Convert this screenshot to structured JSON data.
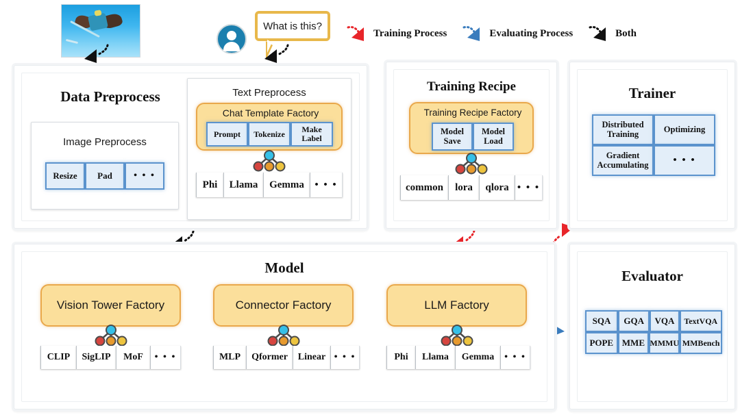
{
  "top": {
    "image_thumb_name": "input-image-kite",
    "user_avatar_name": "user-avatar-icon",
    "question": "What is this?"
  },
  "legend": {
    "items": [
      {
        "label": "Training Process",
        "color": "#e8252a",
        "icon": "red-dotted-arrow-icon"
      },
      {
        "label": "Evaluating Process",
        "color": "#3a7cbd",
        "icon": "blue-dotted-arrow-icon"
      },
      {
        "label": "Both",
        "color": "#111111",
        "icon": "black-dotted-arrow-icon"
      }
    ]
  },
  "colors": {
    "chip_fill": "#e3eef9",
    "chip_border": "#5b93cd",
    "factory_fill": "#fbdf9b",
    "factory_border": "#e9a84b",
    "training_arrow": "#e8252a",
    "evaluating_arrow": "#3a7cbd",
    "both_arrow": "#111111"
  },
  "panels": {
    "data_preprocess": {
      "title": "Data Preprocess",
      "image_preprocess": {
        "title": "Image Preprocess",
        "chips": [
          "Resize",
          "Pad",
          "• • •"
        ]
      },
      "text_preprocess": {
        "title": "Text Preprocess",
        "factory": {
          "title": "Chat Template Factory",
          "chips": [
            "Prompt",
            "Tokenize",
            "Make Label"
          ]
        },
        "options": [
          "Phi",
          "Llama",
          "Gemma",
          "• • •"
        ]
      }
    },
    "training_recipe": {
      "title": "Training Recipe",
      "factory": {
        "title": "Training Recipe Factory",
        "chips": [
          "Model Save",
          "Model Load"
        ]
      },
      "options": [
        "common",
        "lora",
        "qlora",
        "• • •"
      ]
    },
    "trainer": {
      "title": "Trainer",
      "chips": [
        "Distributed Training",
        "Optimizing",
        "Gradient Accumulating",
        "• • •"
      ]
    },
    "model": {
      "title": "Model",
      "factories": [
        {
          "title": "Vision Tower Factory",
          "options": [
            "CLIP",
            "SigLIP",
            "MoF",
            "• • •"
          ]
        },
        {
          "title": "Connector Factory",
          "options": [
            "MLP",
            "Qformer",
            "Linear",
            "• • •"
          ]
        },
        {
          "title": "LLM Factory",
          "options": [
            "Phi",
            "Llama",
            "Gemma",
            "• • •"
          ]
        }
      ]
    },
    "evaluator": {
      "title": "Evaluator",
      "chips_row1": [
        "SQA",
        "GQA",
        "VQA",
        "TextVQA"
      ],
      "chips_row2": [
        "POPE",
        "MME",
        "MMMU",
        "MMBench"
      ]
    }
  },
  "arrows": [
    {
      "name": "arrow-image-to-data-preprocess",
      "type": "both"
    },
    {
      "name": "arrow-question-to-text-preprocess",
      "type": "both"
    },
    {
      "name": "arrow-question-to-legend",
      "type": "training"
    },
    {
      "name": "arrow-data-preprocess-to-model",
      "type": "both"
    },
    {
      "name": "arrow-training-recipe-to-model",
      "type": "training"
    },
    {
      "name": "arrow-model-to-trainer",
      "type": "training"
    },
    {
      "name": "arrow-model-to-evaluator",
      "type": "evaluating"
    }
  ]
}
